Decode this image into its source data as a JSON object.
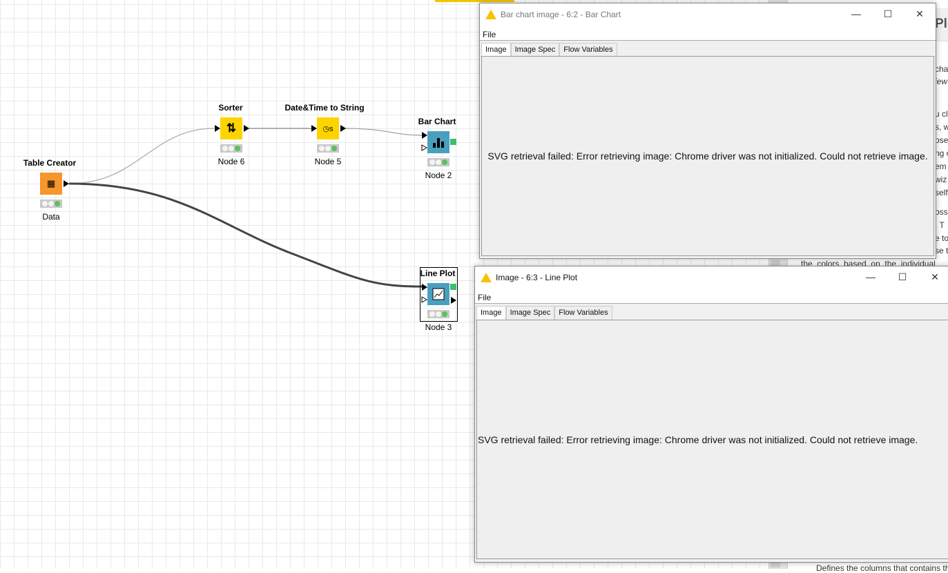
{
  "workflow": {
    "nodes": [
      {
        "title": "Table Creator",
        "label": "Data",
        "color": "#f7952e",
        "icon": "table-plus-icon"
      },
      {
        "title": "Sorter",
        "label": "Node 6",
        "color": "#fdd400",
        "icon": "sort-arrows-icon"
      },
      {
        "title": "Date&Time to String",
        "label": "Node 5",
        "color": "#fdd400",
        "icon": "clock-string-icon"
      },
      {
        "title": "Bar Chart",
        "label": "Node 2",
        "color": "#4a9fbf",
        "icon": "bar-chart-icon"
      },
      {
        "title": "Line Plot",
        "label": "Node 3",
        "color": "#4a9fbf",
        "icon": "line-chart-icon"
      }
    ]
  },
  "description": {
    "header": "Plo",
    "fragments": [
      "cha",
      "iew",
      "u cl",
      "s, w",
      "ose",
      "ng c",
      "em",
      "wiz",
      "self",
      "oss",
      ".  T",
      "e to",
      "se t"
    ],
    "line_colors": "the  colors  based  on  the  individual",
    "line_defines": "Defines the columns that contains th"
  },
  "windows": [
    {
      "title": "Bar chart image - 6:2 - Bar Chart",
      "menu": "File",
      "tabs": [
        "Image",
        "Image Spec",
        "Flow Variables"
      ],
      "message": "SVG retrieval failed: Error retrieving image: Chrome driver was not initialized. Could not retrieve image."
    },
    {
      "title": "Image - 6:3 - Line Plot",
      "menu": "File",
      "tabs": [
        "Image",
        "Image Spec",
        "Flow Variables"
      ],
      "message": "SVG retrieval failed: Error retrieving image: Chrome driver was not initialized. Could not retrieve image."
    }
  ],
  "window_controls": {
    "minimize": "—",
    "maximize": "☐",
    "close": "✕"
  }
}
